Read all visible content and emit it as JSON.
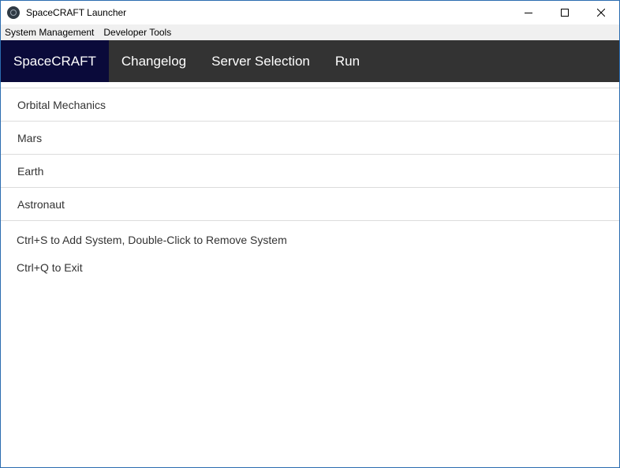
{
  "window": {
    "title": "SpaceCRAFT Launcher"
  },
  "menubar": {
    "items": [
      "System Management",
      "Developer Tools"
    ]
  },
  "navbar": {
    "items": [
      {
        "label": "SpaceCRAFT",
        "active": true
      },
      {
        "label": "Changelog",
        "active": false
      },
      {
        "label": "Server Selection",
        "active": false
      },
      {
        "label": "Run",
        "active": false
      }
    ]
  },
  "systems": {
    "items": [
      "Orbital Mechanics",
      "Mars",
      "Earth",
      "Astronaut"
    ]
  },
  "hints": {
    "add_remove": "Ctrl+S to Add System, Double-Click to Remove System",
    "exit": "Ctrl+Q to Exit"
  },
  "colors": {
    "navbar_bg": "#333333",
    "nav_active_bg": "#0a0a3a",
    "menubar_bg": "#f0f0f0",
    "window_border": "#2b6cb0"
  },
  "icons": {
    "app": "app-logo-icon",
    "minimize": "minimize-icon",
    "maximize": "maximize-icon",
    "close": "close-icon"
  }
}
